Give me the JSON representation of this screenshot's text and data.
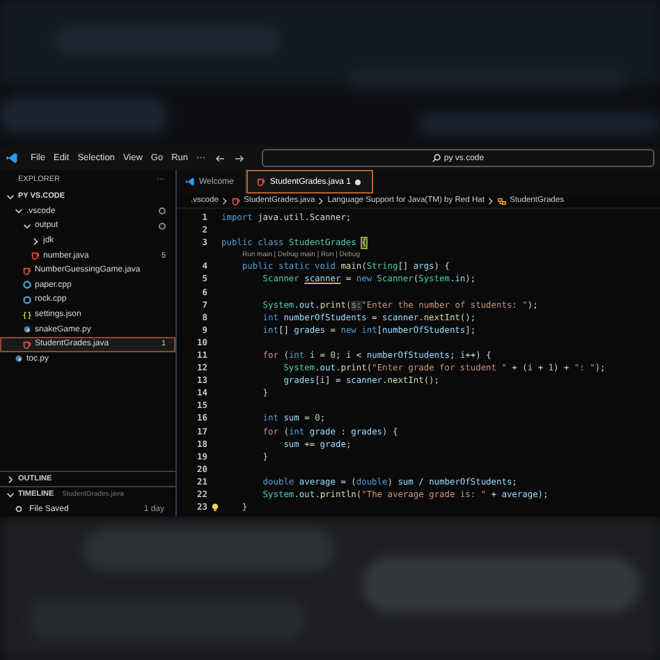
{
  "title_bar": {
    "menu": [
      "File",
      "Edit",
      "Selection",
      "View",
      "Go",
      "Run"
    ],
    "more": "···",
    "search": "py vs.code"
  },
  "sidebar": {
    "title": "EXPLORER",
    "more": "···",
    "tree": [
      {
        "label": "PY VS.CODE",
        "kind": "root",
        "expanded": true,
        "selected": false,
        "modified": false,
        "children": [
          {
            "label": ".vscode",
            "kind": "folder",
            "expanded": true,
            "selected": false,
            "modified": true,
            "children": [
              {
                "label": "output",
                "kind": "folder",
                "expanded": true,
                "selected": false,
                "modified": true,
                "children": [
                  {
                    "label": "jdk",
                    "kind": "folder",
                    "expanded": false,
                    "selected": false,
                    "modified": false
                  },
                  {
                    "label": "number.java",
                    "kind": "java",
                    "selected": false,
                    "modified": false,
                    "badge": "5"
                  }
                ]
              },
              {
                "label": "NumberGuessingGame.java",
                "kind": "java",
                "selected": false,
                "modified": false
              },
              {
                "label": "paper.cpp",
                "kind": "cpp",
                "selected": false,
                "modified": false
              },
              {
                "label": "rock.cpp",
                "kind": "cpp",
                "selected": false,
                "modified": false
              },
              {
                "label": "settings.json",
                "kind": "json",
                "selected": false,
                "modified": false
              },
              {
                "label": "snakeGame.py",
                "kind": "python",
                "selected": false,
                "modified": false
              },
              {
                "label": "StudentGrades.java",
                "kind": "java",
                "selected": true,
                "modified": false,
                "badge": "1"
              }
            ]
          },
          {
            "label": "toc.py",
            "kind": "python",
            "selected": false,
            "modified": false
          }
        ]
      }
    ],
    "panels": [
      {
        "label": "OUTLINE",
        "expanded": false
      },
      {
        "label": "TIMELINE",
        "expanded": true,
        "file": "StudentGrades.java",
        "items": [
          {
            "label": "File Saved",
            "time": "1 day"
          }
        ]
      }
    ]
  },
  "tabs": [
    {
      "label": "Welcome",
      "kind": "welcome",
      "selected": false,
      "modified": false
    },
    {
      "label": "StudentGrades.java",
      "badge": "1",
      "kind": "java",
      "selected": true,
      "modified": true
    }
  ],
  "breadcrumbs": [
    {
      "label": ".vscode",
      "kind": "folder"
    },
    {
      "label": "StudentGrades.java",
      "kind": "java"
    },
    {
      "label": "Language Support for Java(TM) by Red Hat",
      "kind": "folder"
    },
    {
      "label": "StudentGrades",
      "kind": "class"
    }
  ],
  "code": [
    {
      "kind": "code",
      "number": "1",
      "lightbulb": false,
      "tokens": [
        {
          "kind": "kw",
          "text": "import"
        },
        {
          "kind": "p",
          "text": " java.util.Scanner;"
        }
      ]
    },
    {
      "kind": "code",
      "number": "2",
      "lightbulb": false
    },
    {
      "kind": "code",
      "number": "3",
      "lightbulb": false,
      "tokens": [
        {
          "kind": "kw",
          "text": "public class "
        },
        {
          "kind": "type",
          "text": "StudentGrades "
        },
        {
          "kind": "match",
          "text": "{"
        }
      ]
    },
    {
      "kind": "lens",
      "text": "Run main | Debug main | Run | Debug"
    },
    {
      "kind": "code",
      "number": "4",
      "lightbulb": false,
      "tokens": [
        {
          "kind": "kw",
          "text": "    public static void "
        },
        {
          "kind": "fn",
          "text": "main"
        },
        {
          "kind": "p",
          "text": "("
        },
        {
          "kind": "type",
          "text": "String"
        },
        {
          "kind": "p",
          "text": "[] "
        },
        {
          "kind": "var",
          "text": "args"
        },
        {
          "kind": "p",
          "text": ") {"
        }
      ]
    },
    {
      "kind": "code",
      "number": "5",
      "lightbulb": false,
      "tokens": [
        {
          "kind": "type",
          "text": "        Scanner "
        },
        {
          "kind": "ul",
          "text": "scanner"
        },
        {
          "kind": "p",
          "text": " = "
        },
        {
          "kind": "kw",
          "text": "new "
        },
        {
          "kind": "type",
          "text": "Scanner"
        },
        {
          "kind": "p",
          "text": "("
        },
        {
          "kind": "type",
          "text": "System"
        },
        {
          "kind": "p",
          "text": "."
        },
        {
          "kind": "var",
          "text": "in"
        },
        {
          "kind": "p",
          "text": ");"
        }
      ]
    },
    {
      "kind": "code",
      "number": "6",
      "lightbulb": false
    },
    {
      "kind": "code",
      "number": "7",
      "lightbulb": false,
      "tokens": [
        {
          "kind": "type",
          "text": "        System"
        },
        {
          "kind": "p",
          "text": "."
        },
        {
          "kind": "var",
          "text": "out"
        },
        {
          "kind": "p",
          "text": "."
        },
        {
          "kind": "fn",
          "text": "print"
        },
        {
          "kind": "p",
          "text": "("
        },
        {
          "kind": "hint",
          "text": "s:"
        },
        {
          "kind": "str",
          "text": "\"Enter the number of students: \""
        },
        {
          "kind": "p",
          "text": ");"
        }
      ]
    },
    {
      "kind": "code",
      "number": "8",
      "lightbulb": false,
      "tokens": [
        {
          "kind": "kw",
          "text": "        int "
        },
        {
          "kind": "var",
          "text": "numberOfStudents"
        },
        {
          "kind": "p",
          "text": " = "
        },
        {
          "kind": "var",
          "text": "scanner"
        },
        {
          "kind": "p",
          "text": "."
        },
        {
          "kind": "fn",
          "text": "nextInt"
        },
        {
          "kind": "p",
          "text": "();"
        }
      ]
    },
    {
      "kind": "code",
      "number": "9",
      "lightbulb": false,
      "tokens": [
        {
          "kind": "kw",
          "text": "        int"
        },
        {
          "kind": "p",
          "text": "[] "
        },
        {
          "kind": "var",
          "text": "grades"
        },
        {
          "kind": "p",
          "text": " = "
        },
        {
          "kind": "kw",
          "text": "new int"
        },
        {
          "kind": "p",
          "text": "["
        },
        {
          "kind": "var",
          "text": "numberOfStudents"
        },
        {
          "kind": "p",
          "text": "];"
        }
      ]
    },
    {
      "kind": "code",
      "number": "10",
      "lightbulb": false
    },
    {
      "kind": "code",
      "number": "11",
      "lightbulb": false,
      "tokens": [
        {
          "kind": "ctl",
          "text": "        for"
        },
        {
          "kind": "p",
          "text": " ("
        },
        {
          "kind": "kw",
          "text": "int "
        },
        {
          "kind": "var",
          "text": "i"
        },
        {
          "kind": "p",
          "text": " = "
        },
        {
          "kind": "num",
          "text": "0"
        },
        {
          "kind": "p",
          "text": "; "
        },
        {
          "kind": "var",
          "text": "i"
        },
        {
          "kind": "p",
          "text": " < "
        },
        {
          "kind": "var",
          "text": "numberOfStudents"
        },
        {
          "kind": "p",
          "text": "; "
        },
        {
          "kind": "var",
          "text": "i"
        },
        {
          "kind": "p",
          "text": "++) {"
        }
      ]
    },
    {
      "kind": "code",
      "number": "12",
      "lightbulb": false,
      "tokens": [
        {
          "kind": "type",
          "text": "            System"
        },
        {
          "kind": "p",
          "text": "."
        },
        {
          "kind": "var",
          "text": "out"
        },
        {
          "kind": "p",
          "text": "."
        },
        {
          "kind": "fn",
          "text": "print"
        },
        {
          "kind": "p",
          "text": "("
        },
        {
          "kind": "str",
          "text": "\"Enter grade for student \""
        },
        {
          "kind": "p",
          "text": " + ("
        },
        {
          "kind": "var",
          "text": "i"
        },
        {
          "kind": "p",
          "text": " + "
        },
        {
          "kind": "num",
          "text": "1"
        },
        {
          "kind": "p",
          "text": ") + "
        },
        {
          "kind": "str",
          "text": "\": \""
        },
        {
          "kind": "p",
          "text": ");"
        }
      ]
    },
    {
      "kind": "code",
      "number": "13",
      "lightbulb": false,
      "tokens": [
        {
          "kind": "var",
          "text": "            grades"
        },
        {
          "kind": "p",
          "text": "["
        },
        {
          "kind": "var",
          "text": "i"
        },
        {
          "kind": "p",
          "text": "] = "
        },
        {
          "kind": "var",
          "text": "scanner"
        },
        {
          "kind": "p",
          "text": "."
        },
        {
          "kind": "fn",
          "text": "nextInt"
        },
        {
          "kind": "p",
          "text": "();"
        }
      ]
    },
    {
      "kind": "code",
      "number": "14",
      "lightbulb": false,
      "tokens": [
        {
          "kind": "p",
          "text": "        }"
        }
      ]
    },
    {
      "kind": "code",
      "number": "15",
      "lightbulb": false
    },
    {
      "kind": "code",
      "number": "16",
      "lightbulb": false,
      "tokens": [
        {
          "kind": "kw",
          "text": "        int "
        },
        {
          "kind": "var",
          "text": "sum"
        },
        {
          "kind": "p",
          "text": " = "
        },
        {
          "kind": "num",
          "text": "0"
        },
        {
          "kind": "p",
          "text": ";"
        }
      ]
    },
    {
      "kind": "code",
      "number": "17",
      "lightbulb": false,
      "tokens": [
        {
          "kind": "ctl",
          "text": "        for"
        },
        {
          "kind": "p",
          "text": " ("
        },
        {
          "kind": "kw",
          "text": "int "
        },
        {
          "kind": "var",
          "text": "grade"
        },
        {
          "kind": "p",
          "text": " : "
        },
        {
          "kind": "var",
          "text": "grades"
        },
        {
          "kind": "p",
          "text": ") {"
        }
      ]
    },
    {
      "kind": "code",
      "number": "18",
      "lightbulb": false,
      "tokens": [
        {
          "kind": "var",
          "text": "            sum"
        },
        {
          "kind": "p",
          "text": " += "
        },
        {
          "kind": "var",
          "text": "grade"
        },
        {
          "kind": "p",
          "text": ";"
        }
      ]
    },
    {
      "kind": "code",
      "number": "19",
      "lightbulb": false,
      "tokens": [
        {
          "kind": "p",
          "text": "        }"
        }
      ]
    },
    {
      "kind": "code",
      "number": "20",
      "lightbulb": false
    },
    {
      "kind": "code",
      "number": "21",
      "lightbulb": false,
      "tokens": [
        {
          "kind": "kw",
          "text": "        double "
        },
        {
          "kind": "var",
          "text": "average"
        },
        {
          "kind": "p",
          "text": " = ("
        },
        {
          "kind": "kw",
          "text": "double"
        },
        {
          "kind": "p",
          "text": ") "
        },
        {
          "kind": "var",
          "text": "sum"
        },
        {
          "kind": "p",
          "text": " / "
        },
        {
          "kind": "var",
          "text": "numberOfStudents"
        },
        {
          "kind": "p",
          "text": ";"
        }
      ]
    },
    {
      "kind": "code",
      "number": "22",
      "lightbulb": false,
      "tokens": [
        {
          "kind": "type",
          "text": "        System"
        },
        {
          "kind": "p",
          "text": "."
        },
        {
          "kind": "var",
          "text": "out"
        },
        {
          "kind": "p",
          "text": "."
        },
        {
          "kind": "fn",
          "text": "println"
        },
        {
          "kind": "p",
          "text": "("
        },
        {
          "kind": "str",
          "text": "\"The average grade is: \""
        },
        {
          "kind": "p",
          "text": " + "
        },
        {
          "kind": "var",
          "text": "average"
        },
        {
          "kind": "p",
          "text": ");"
        }
      ]
    },
    {
      "kind": "code",
      "number": "23",
      "lightbulb": true,
      "tokens": [
        {
          "kind": "p",
          "text": "    }"
        }
      ]
    }
  ]
}
